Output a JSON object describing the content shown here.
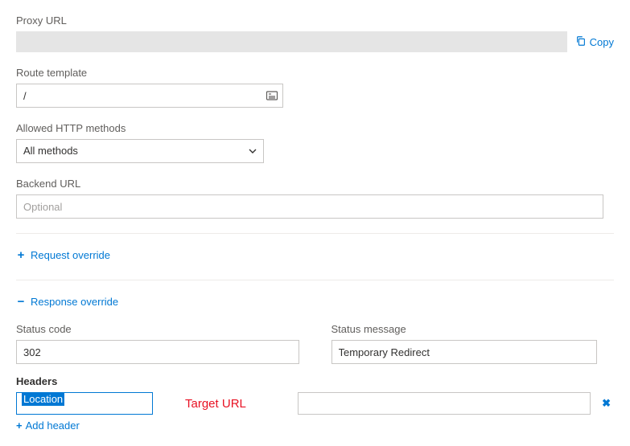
{
  "proxy": {
    "label": "Proxy URL",
    "value": "",
    "copy_label": "Copy"
  },
  "route": {
    "label": "Route template",
    "value": "/"
  },
  "methods": {
    "label": "Allowed HTTP methods",
    "selected": "All methods"
  },
  "backend": {
    "label": "Backend URL",
    "placeholder": "Optional",
    "value": ""
  },
  "request_override": {
    "toggle_label": "Request override"
  },
  "response_override": {
    "toggle_label": "Response override",
    "status_code_label": "Status code",
    "status_code_value": "302",
    "status_message_label": "Status message",
    "status_message_value": "Temporary Redirect",
    "headers_label": "Headers",
    "header_key": "Location",
    "header_annotation": "Target URL",
    "header_value": "",
    "add_header_label": "Add header"
  }
}
